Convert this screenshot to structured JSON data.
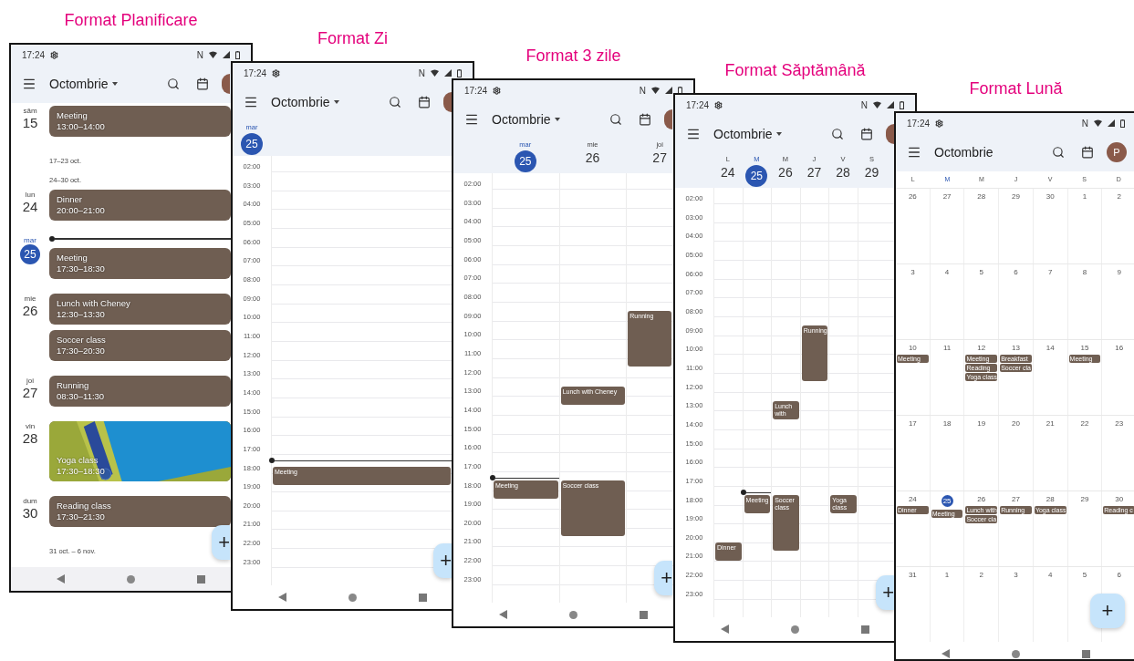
{
  "phones": [
    {
      "caption": "Format Planificare",
      "kind": "planning",
      "status": {
        "time": "17:24",
        "nfc": "N"
      },
      "title": "Octombrie",
      "dropdown": true,
      "fab": "+",
      "agenda": [
        {
          "kind": "day",
          "dow": "săm",
          "day": "15",
          "selected": false,
          "now": false,
          "events": [
            {
              "kind": "plain",
              "title": "Meeting",
              "time": "13:00–14:00"
            }
          ]
        },
        {
          "kind": "range",
          "label": "17–23 oct."
        },
        {
          "kind": "range",
          "label": "24–30 oct."
        },
        {
          "kind": "day",
          "dow": "lun",
          "day": "24",
          "selected": false,
          "now": false,
          "events": [
            {
              "kind": "plain",
              "title": "Dinner",
              "time": "20:00–21:00"
            }
          ]
        },
        {
          "kind": "day",
          "dow": "mar",
          "day": "25",
          "selected": true,
          "now": true,
          "events": [
            {
              "kind": "plain",
              "title": "Meeting",
              "time": "17:30–18:30"
            }
          ]
        },
        {
          "kind": "day",
          "dow": "mie",
          "day": "26",
          "selected": false,
          "now": false,
          "events": [
            {
              "kind": "plain",
              "title": "Lunch with Cheney",
              "time": "12:30–13:30"
            },
            {
              "kind": "plain",
              "title": "Soccer class",
              "time": "17:30–20:30"
            }
          ]
        },
        {
          "kind": "day",
          "dow": "joi",
          "day": "27",
          "selected": false,
          "now": false,
          "events": [
            {
              "kind": "plain",
              "title": "Running",
              "time": "08:30–11:30"
            }
          ]
        },
        {
          "kind": "day",
          "dow": "vin",
          "day": "28",
          "selected": false,
          "now": false,
          "events": [
            {
              "kind": "image",
              "title": "Yoga class",
              "time": "17:30–18:30"
            }
          ]
        },
        {
          "kind": "day",
          "dow": "dum",
          "day": "30",
          "selected": false,
          "now": false,
          "events": [
            {
              "kind": "plain",
              "title": "Reading class",
              "time": "17:30–21:30"
            }
          ]
        },
        {
          "kind": "range",
          "label": "31 oct. – 6 nov."
        }
      ]
    },
    {
      "caption": "Format Zi",
      "kind": "day",
      "status": {
        "time": "17:24",
        "nfc": "N"
      },
      "title": "Octombrie",
      "dropdown": true,
      "fab": "+",
      "hours": [
        "02:00",
        "03:00",
        "04:00",
        "05:00",
        "06:00",
        "07:00",
        "08:00",
        "09:00",
        "10:00",
        "11:00",
        "12:00",
        "13:00",
        "14:00",
        "15:00",
        "16:00",
        "17:00",
        "18:00",
        "19:00",
        "20:00",
        "21:00",
        "22:00",
        "23:00"
      ],
      "days": [
        {
          "dow": "mar",
          "day": "25",
          "selected": true,
          "events": [
            {
              "title": "Meeting"
            }
          ]
        }
      ]
    },
    {
      "caption": "Format 3 zile",
      "kind": "threeday",
      "status": {
        "time": "17:24",
        "nfc": "N"
      },
      "title": "Octombrie",
      "dropdown": true,
      "fab": "+",
      "hours": [
        "02:00",
        "03:00",
        "04:00",
        "05:00",
        "06:00",
        "07:00",
        "08:00",
        "09:00",
        "10:00",
        "11:00",
        "12:00",
        "13:00",
        "14:00",
        "15:00",
        "16:00",
        "17:00",
        "18:00",
        "19:00",
        "20:00",
        "21:00",
        "22:00",
        "23:00"
      ],
      "days": [
        {
          "dow": "mar",
          "day": "25",
          "selected": true,
          "events": [
            {
              "title": "Meeting"
            }
          ]
        },
        {
          "dow": "mie",
          "day": "26",
          "selected": false,
          "events": [
            {
              "title": "Lunch with Cheney"
            },
            {
              "title": "Soccer class"
            }
          ]
        },
        {
          "dow": "joi",
          "day": "27",
          "selected": false,
          "events": [
            {
              "title": "Running"
            }
          ]
        }
      ]
    },
    {
      "caption": "Format Săptămână",
      "kind": "week",
      "status": {
        "time": "17:24",
        "nfc": "N"
      },
      "title": "Octombrie",
      "dropdown": true,
      "fab": "+",
      "hours": [
        "02:00",
        "03:00",
        "04:00",
        "05:00",
        "06:00",
        "07:00",
        "08:00",
        "09:00",
        "10:00",
        "11:00",
        "12:00",
        "13:00",
        "14:00",
        "15:00",
        "16:00",
        "17:00",
        "18:00",
        "19:00",
        "20:00",
        "21:00",
        "22:00",
        "23:00"
      ],
      "days": [
        {
          "dow": "L",
          "day": "24",
          "selected": false,
          "events": [
            {
              "title": "Dinner"
            }
          ]
        },
        {
          "dow": "M",
          "day": "25",
          "selected": true,
          "events": [
            {
              "title": "Meeting"
            }
          ]
        },
        {
          "dow": "M",
          "day": "26",
          "selected": false,
          "events": [
            {
              "title": "Lunch with"
            },
            {
              "title": "Soccer class"
            }
          ]
        },
        {
          "dow": "J",
          "day": "27",
          "selected": false,
          "events": [
            {
              "title": "Running"
            }
          ]
        },
        {
          "dow": "V",
          "day": "28",
          "selected": false,
          "events": [
            {
              "title": "Yoga class"
            }
          ]
        },
        {
          "dow": "S",
          "day": "29",
          "selected": false
        }
      ]
    },
    {
      "caption": "Format Lună",
      "kind": "month",
      "status": {
        "time": "17:24",
        "nfc": "N"
      },
      "title": "Octombrie",
      "dropdown": false,
      "avatar": "P",
      "fab": "+",
      "weekdays": [
        {
          "label": "L",
          "selected": false
        },
        {
          "label": "M",
          "selected": true
        },
        {
          "label": "M",
          "selected": false
        },
        {
          "label": "J",
          "selected": false
        },
        {
          "label": "V",
          "selected": false
        },
        {
          "label": "S",
          "selected": false
        },
        {
          "label": "D",
          "selected": false
        }
      ],
      "weeks": [
        [
          {
            "day": "26",
            "selected": false
          },
          {
            "day": "27",
            "selected": false
          },
          {
            "day": "28",
            "selected": false
          },
          {
            "day": "29",
            "selected": false
          },
          {
            "day": "30",
            "selected": false
          },
          {
            "day": "1",
            "selected": false
          },
          {
            "day": "2",
            "selected": false
          }
        ],
        [
          {
            "day": "3",
            "selected": false
          },
          {
            "day": "4",
            "selected": false
          },
          {
            "day": "5",
            "selected": false
          },
          {
            "day": "6",
            "selected": false
          },
          {
            "day": "7",
            "selected": false
          },
          {
            "day": "8",
            "selected": false
          },
          {
            "day": "9",
            "selected": false
          }
        ],
        [
          {
            "day": "10",
            "selected": false,
            "events": [
              "Meeting"
            ]
          },
          {
            "day": "11",
            "selected": false
          },
          {
            "day": "12",
            "selected": false,
            "events": [
              "Meeting",
              "Reading",
              "Yoga class"
            ]
          },
          {
            "day": "13",
            "selected": false,
            "events": [
              "Breakfast",
              "Soccer cla"
            ]
          },
          {
            "day": "14",
            "selected": false
          },
          {
            "day": "15",
            "selected": false,
            "events": [
              "Meeting"
            ]
          },
          {
            "day": "16",
            "selected": false
          }
        ],
        [
          {
            "day": "17",
            "selected": false
          },
          {
            "day": "18",
            "selected": false
          },
          {
            "day": "19",
            "selected": false
          },
          {
            "day": "20",
            "selected": false
          },
          {
            "day": "21",
            "selected": false
          },
          {
            "day": "22",
            "selected": false
          },
          {
            "day": "23",
            "selected": false
          }
        ],
        [
          {
            "day": "24",
            "selected": false,
            "events": [
              "Dinner"
            ]
          },
          {
            "day": "25",
            "selected": true,
            "events": [
              "Meeting"
            ]
          },
          {
            "day": "26",
            "selected": false,
            "events": [
              "Lunch with",
              "Soccer cla"
            ]
          },
          {
            "day": "27",
            "selected": false,
            "events": [
              "Running"
            ]
          },
          {
            "day": "28",
            "selected": false,
            "events": [
              "Yoga class"
            ]
          },
          {
            "day": "29",
            "selected": false
          },
          {
            "day": "30",
            "selected": false,
            "events": [
              "Reading c"
            ]
          }
        ],
        [
          {
            "day": "31",
            "selected": false
          },
          {
            "day": "1",
            "selected": false
          },
          {
            "day": "2",
            "selected": false
          },
          {
            "day": "3",
            "selected": false
          },
          {
            "day": "4",
            "selected": false
          },
          {
            "day": "5",
            "selected": false
          },
          {
            "day": "6",
            "selected": false
          }
        ]
      ]
    }
  ]
}
